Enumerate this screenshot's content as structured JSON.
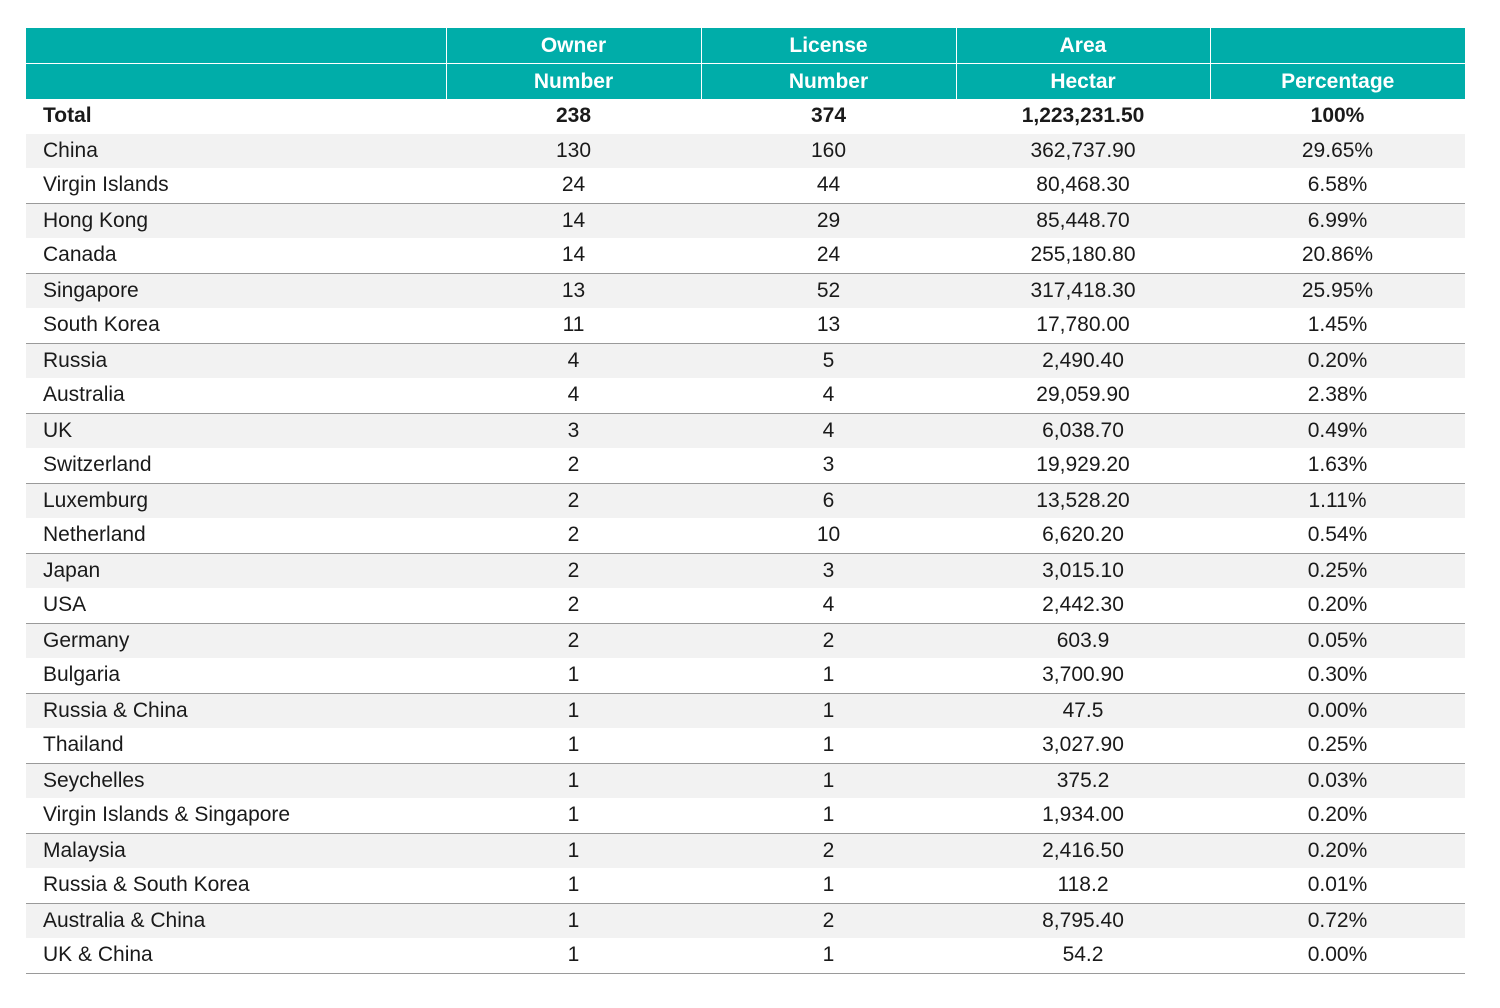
{
  "header": {
    "row1": [
      "",
      "Owner",
      "License",
      "Area",
      ""
    ],
    "row2": [
      "",
      "Number",
      "Number",
      "Hectar",
      "Percentage"
    ]
  },
  "total": {
    "label": "Total",
    "owner": "238",
    "license": "374",
    "area": "1,223,231.50",
    "percentage": "100%"
  },
  "rows": [
    {
      "country": "China",
      "owner": "130",
      "license": "160",
      "area": "362,737.90",
      "percentage": "29.65%"
    },
    {
      "country": "Virgin Islands",
      "owner": "24",
      "license": "44",
      "area": "80,468.30",
      "percentage": "6.58%"
    },
    {
      "country": "Hong Kong",
      "owner": "14",
      "license": "29",
      "area": "85,448.70",
      "percentage": "6.99%"
    },
    {
      "country": "Canada",
      "owner": "14",
      "license": "24",
      "area": "255,180.80",
      "percentage": "20.86%"
    },
    {
      "country": "Singapore",
      "owner": "13",
      "license": "52",
      "area": "317,418.30",
      "percentage": "25.95%"
    },
    {
      "country": "South Korea",
      "owner": "11",
      "license": "13",
      "area": "17,780.00",
      "percentage": "1.45%"
    },
    {
      "country": "Russia",
      "owner": "4",
      "license": "5",
      "area": "2,490.40",
      "percentage": "0.20%"
    },
    {
      "country": "Australia",
      "owner": "4",
      "license": "4",
      "area": "29,059.90",
      "percentage": "2.38%"
    },
    {
      "country": "UK",
      "owner": "3",
      "license": "4",
      "area": "6,038.70",
      "percentage": "0.49%"
    },
    {
      "country": "Switzerland",
      "owner": "2",
      "license": "3",
      "area": "19,929.20",
      "percentage": "1.63%"
    },
    {
      "country": "Luxemburg",
      "owner": "2",
      "license": "6",
      "area": "13,528.20",
      "percentage": "1.11%"
    },
    {
      "country": "Netherland",
      "owner": "2",
      "license": "10",
      "area": "6,620.20",
      "percentage": "0.54%"
    },
    {
      "country": "Japan",
      "owner": "2",
      "license": "3",
      "area": "3,015.10",
      "percentage": "0.25%"
    },
    {
      "country": "USA",
      "owner": "2",
      "license": "4",
      "area": "2,442.30",
      "percentage": "0.20%"
    },
    {
      "country": "Germany",
      "owner": "2",
      "license": "2",
      "area": "603.9",
      "percentage": "0.05%"
    },
    {
      "country": "Bulgaria",
      "owner": "1",
      "license": "1",
      "area": "3,700.90",
      "percentage": "0.30%"
    },
    {
      "country": "Russia & China",
      "owner": "1",
      "license": "1",
      "area": "47.5",
      "percentage": "0.00%"
    },
    {
      "country": "Thailand",
      "owner": "1",
      "license": "1",
      "area": "3,027.90",
      "percentage": "0.25%"
    },
    {
      "country": "Seychelles",
      "owner": "1",
      "license": "1",
      "area": "375.2",
      "percentage": "0.03%"
    },
    {
      "country": "Virgin Islands & Singapore",
      "owner": "1",
      "license": "1",
      "area": "1,934.00",
      "percentage": "0.20%"
    },
    {
      "country": "Malaysia",
      "owner": "1",
      "license": "2",
      "area": "2,416.50",
      "percentage": "0.20%"
    },
    {
      "country": "Russia & South Korea",
      "owner": "1",
      "license": "1",
      "area": "118.2",
      "percentage": "0.01%"
    },
    {
      "country": "Australia & China",
      "owner": "1",
      "license": "2",
      "area": "8,795.40",
      "percentage": "0.72%"
    },
    {
      "country": "UK & China",
      "owner": "1",
      "license": "1",
      "area": "54.2",
      "percentage": "0.00%"
    }
  ],
  "colors": {
    "header_bg": "#00ada9",
    "header_text": "#ffffff",
    "row_shade": "#f2f2f2",
    "rule": "#9a9a9a"
  }
}
